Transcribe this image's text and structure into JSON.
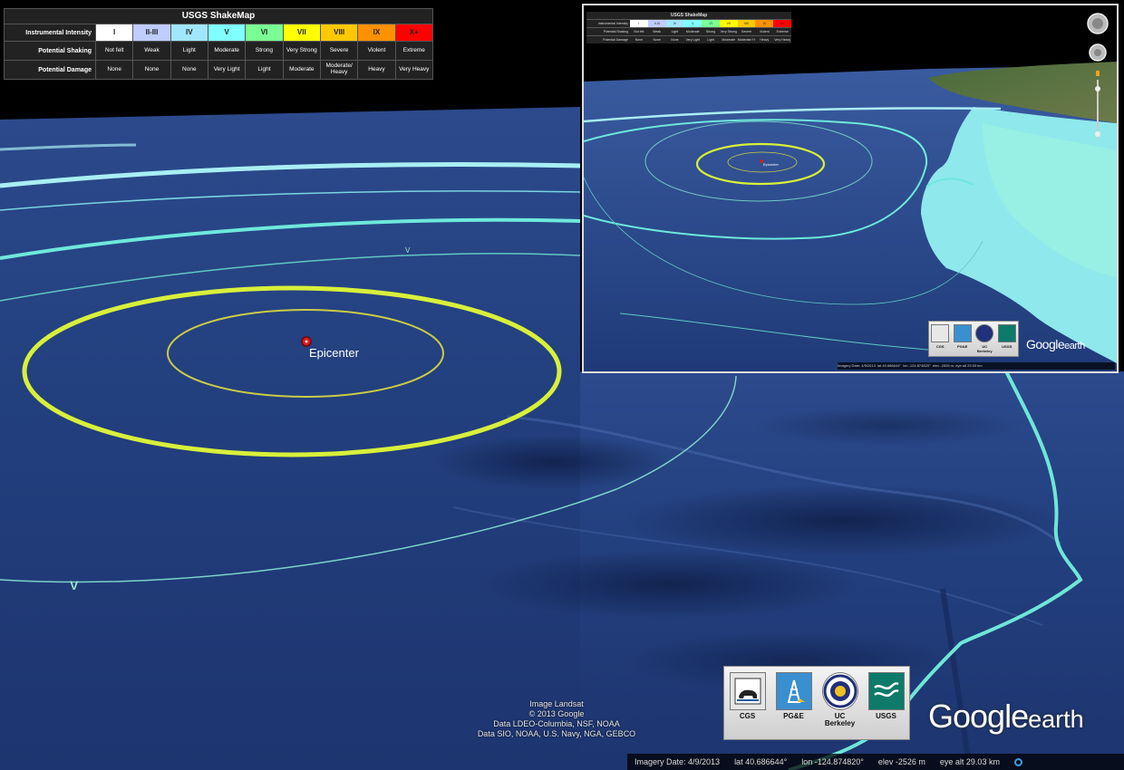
{
  "legend": {
    "title": "USGS ShakeMap",
    "rows": {
      "intensity_label": "Instrumental Intensity",
      "shaking_label": "Potential Shaking",
      "damage_label": "Potential Damage"
    },
    "intensity": [
      "I",
      "II-III",
      "IV",
      "V",
      "VI",
      "VII",
      "VIII",
      "IX",
      "X+"
    ],
    "colors": [
      "#ffffff",
      "#bfccff",
      "#a0e6ff",
      "#80ffff",
      "#7aff93",
      "#ffff00",
      "#ffc800",
      "#ff9100",
      "#ff0000"
    ],
    "shaking": [
      "Not felt",
      "Weak",
      "Light",
      "Moderate",
      "Strong",
      "Very Strong",
      "Severe",
      "Violent",
      "Extreme"
    ],
    "damage": [
      "None",
      "None",
      "None",
      "Very Light",
      "Light",
      "Moderate",
      "Moderate/ Heavy",
      "Heavy",
      "Very Heavy"
    ]
  },
  "map": {
    "epicenter_label": "Epicenter",
    "contour_label": "V"
  },
  "logos": [
    "CGS",
    "PG&E",
    "UC Berkeley",
    "USGS"
  ],
  "credits": [
    "Image Landsat",
    "© 2013 Google",
    "Data LDEO-Columbia, NSF, NOAA",
    "Data SIO, NOAA, U.S. Navy, NGA, GEBCO"
  ],
  "brand": {
    "name": "Google",
    "suffix": "earth"
  },
  "status": {
    "imagery_date": "Imagery Date: 4/9/2013",
    "lat": "lat 40.686644°",
    "lon": "lon -124.874820°",
    "elev": "elev -2526 m",
    "eye_alt": "eye alt 29.03 km"
  }
}
